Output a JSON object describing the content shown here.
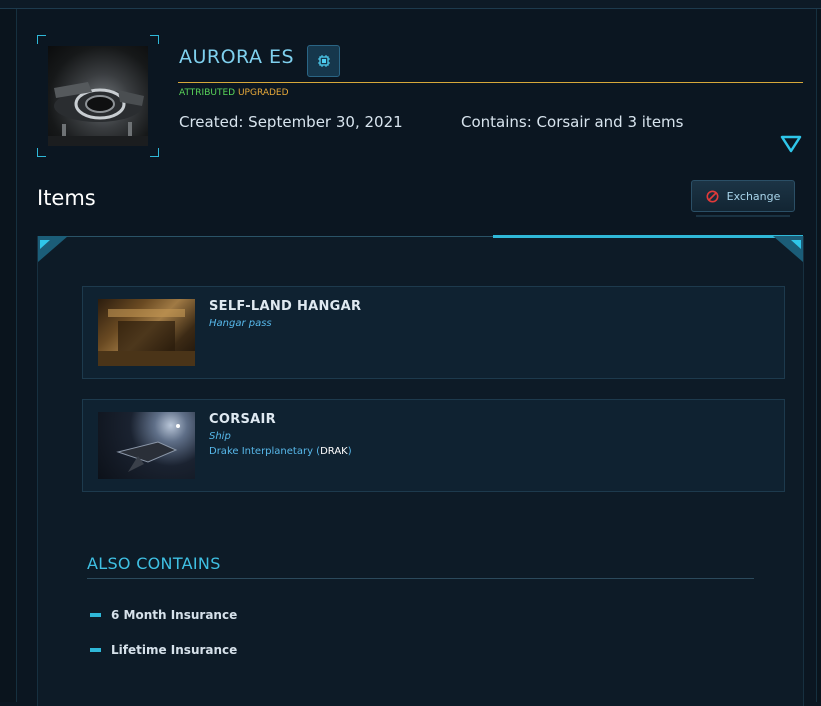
{
  "package": {
    "title": "AURORA ES",
    "badge_attributed": "ATTRIBUTED",
    "badge_upgraded": "UPGRADED",
    "created": "Created: September 30, 2021",
    "contains": "Contains: Corsair and 3 items",
    "chip_icon": "chip-icon",
    "expand_icon": "chevron-down-icon"
  },
  "items_section": {
    "title": "Items",
    "exchange_label": "Exchange",
    "exchange_icon": "no-entry-icon"
  },
  "items": [
    {
      "title": "SELF-LAND HANGAR",
      "type": "Hangar pass"
    },
    {
      "title": "CORSAIR",
      "type": "Ship",
      "manufacturer": "Drake Interplanetary",
      "manufacturer_code": "DRAK"
    }
  ],
  "also_contains": {
    "title": "ALSO CONTAINS",
    "entries": [
      "6 Month Insurance",
      "Lifetime Insurance"
    ]
  },
  "colors": {
    "accent": "#2fb8d8",
    "title_blue": "#7fd0ee",
    "gold": "#d7a83a",
    "attributed": "#5ad65a",
    "upgraded": "#e6a83a",
    "link_blue": "#57b8ea",
    "background": "#0b1621"
  }
}
